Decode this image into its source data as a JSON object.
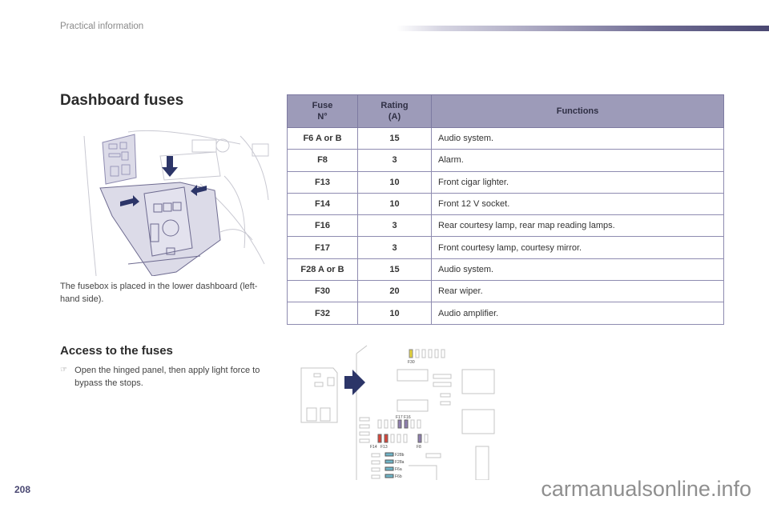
{
  "header": {
    "section": "Practical information"
  },
  "title": "Dashboard fuses",
  "description": "The fusebox is placed in the lower dashboard (left-hand side).",
  "access": {
    "title": "Access to the fuses",
    "bullet_icon": "pointing-hand-icon",
    "steps": [
      "Open the hinged panel, then apply light force to bypass the stops."
    ]
  },
  "table": {
    "headers": [
      "Fuse N°",
      "Rating (A)",
      "Functions"
    ],
    "header_lines": {
      "fuse": [
        "Fuse",
        "N°"
      ],
      "rating": [
        "Rating",
        "(A)"
      ]
    },
    "rows": [
      {
        "fuse": "F6 A or B",
        "rating": "15",
        "function": "Audio system."
      },
      {
        "fuse": "F8",
        "rating": "3",
        "function": "Alarm."
      },
      {
        "fuse": "F13",
        "rating": "10",
        "function": "Front cigar lighter."
      },
      {
        "fuse": "F14",
        "rating": "10",
        "function": "Front 12 V socket."
      },
      {
        "fuse": "F16",
        "rating": "3",
        "function": "Rear courtesy lamp, rear map reading lamps."
      },
      {
        "fuse": "F17",
        "rating": "3",
        "function": "Front courtesy lamp, courtesy mirror."
      },
      {
        "fuse": "F28 A or B",
        "rating": "15",
        "function": "Audio system."
      },
      {
        "fuse": "F30",
        "rating": "20",
        "function": "Rear wiper."
      },
      {
        "fuse": "F32",
        "rating": "10",
        "function": "Audio amplifier."
      }
    ]
  },
  "diagram_labels": {
    "f30": "F30",
    "f17": "F17",
    "f16": "F16",
    "f14": "F14",
    "f13": "F13",
    "f8": "F8",
    "f28b": "F28b",
    "f28a": "F28a",
    "f6a": "F6a",
    "f6b": "F6b"
  },
  "colors": {
    "accent": "#4a4872",
    "table_header": "#9d9bb9",
    "fuse_yellow": "#e3d23a",
    "fuse_red": "#d9453a",
    "fuse_purple": "#8f7fb0",
    "fuse_blue": "#6fb5c9"
  },
  "footer": {
    "page_number": "208",
    "watermark": "carmanualsonline.info"
  }
}
